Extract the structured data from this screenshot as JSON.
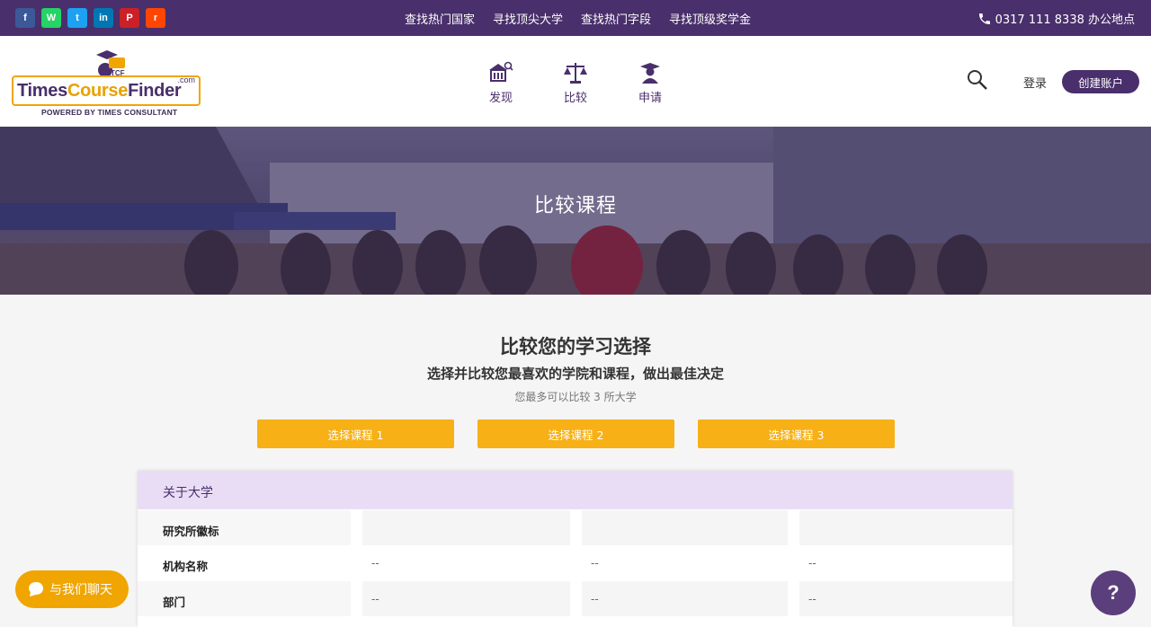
{
  "topbar": {
    "social": [
      {
        "icon": "facebook-icon",
        "glyph": "f",
        "color": "#3b5998"
      },
      {
        "icon": "whatsapp-icon",
        "glyph": "W",
        "color": "#25d366"
      },
      {
        "icon": "twitter-icon",
        "glyph": "t",
        "color": "#1da1f2"
      },
      {
        "icon": "linkedin-icon",
        "glyph": "in",
        "color": "#0077b5"
      },
      {
        "icon": "pinterest-icon",
        "glyph": "P",
        "color": "#cb2027"
      },
      {
        "icon": "reddit-icon",
        "glyph": "r",
        "color": "#ff4500"
      }
    ],
    "links": [
      "查找热门国家",
      "寻找顶尖大学",
      "查找热门字段",
      "寻找顶级奖学金"
    ],
    "phone_text": "0317 111 8338 办公地点"
  },
  "header": {
    "logo": {
      "brand_part1": "Times",
      "brand_part2": "Course",
      "brand_part3": "Finder",
      "dotcom": ".com",
      "badge": "TCF",
      "powered_by": "POWERED BY TIMES CONSULTANT"
    },
    "nav": [
      {
        "label": "发现",
        "icon": "discover-icon"
      },
      {
        "label": "比较",
        "icon": "compare-scale-icon"
      },
      {
        "label": "申请",
        "icon": "apply-graduate-icon"
      }
    ],
    "login_label": "登录",
    "create_account_label": "创建账户"
  },
  "hero": {
    "title": "比较课程"
  },
  "compare": {
    "title": "比较您的学习选择",
    "subtitle": "选择并比较您最喜欢的学院和课程，做出最佳决定",
    "note": "您最多可以比较 3 所大学",
    "buttons": [
      "选择课程 1",
      "选择课程 2",
      "选择课程 3"
    ]
  },
  "table": {
    "section_title": "关于大学",
    "rows": [
      {
        "label": "研究所徽标",
        "values": [
          "",
          "",
          ""
        ]
      },
      {
        "label": "机构名称",
        "values": [
          "--",
          "--",
          "--"
        ]
      },
      {
        "label": "部门",
        "values": [
          "--",
          "--",
          "--"
        ]
      }
    ]
  },
  "chat": {
    "label": "与我们聊天"
  },
  "help": {
    "label": "?"
  },
  "colors": {
    "brand_purple": "#492f6b",
    "accent_yellow": "#f7b016",
    "table_header_bg": "#e9ddf5"
  }
}
